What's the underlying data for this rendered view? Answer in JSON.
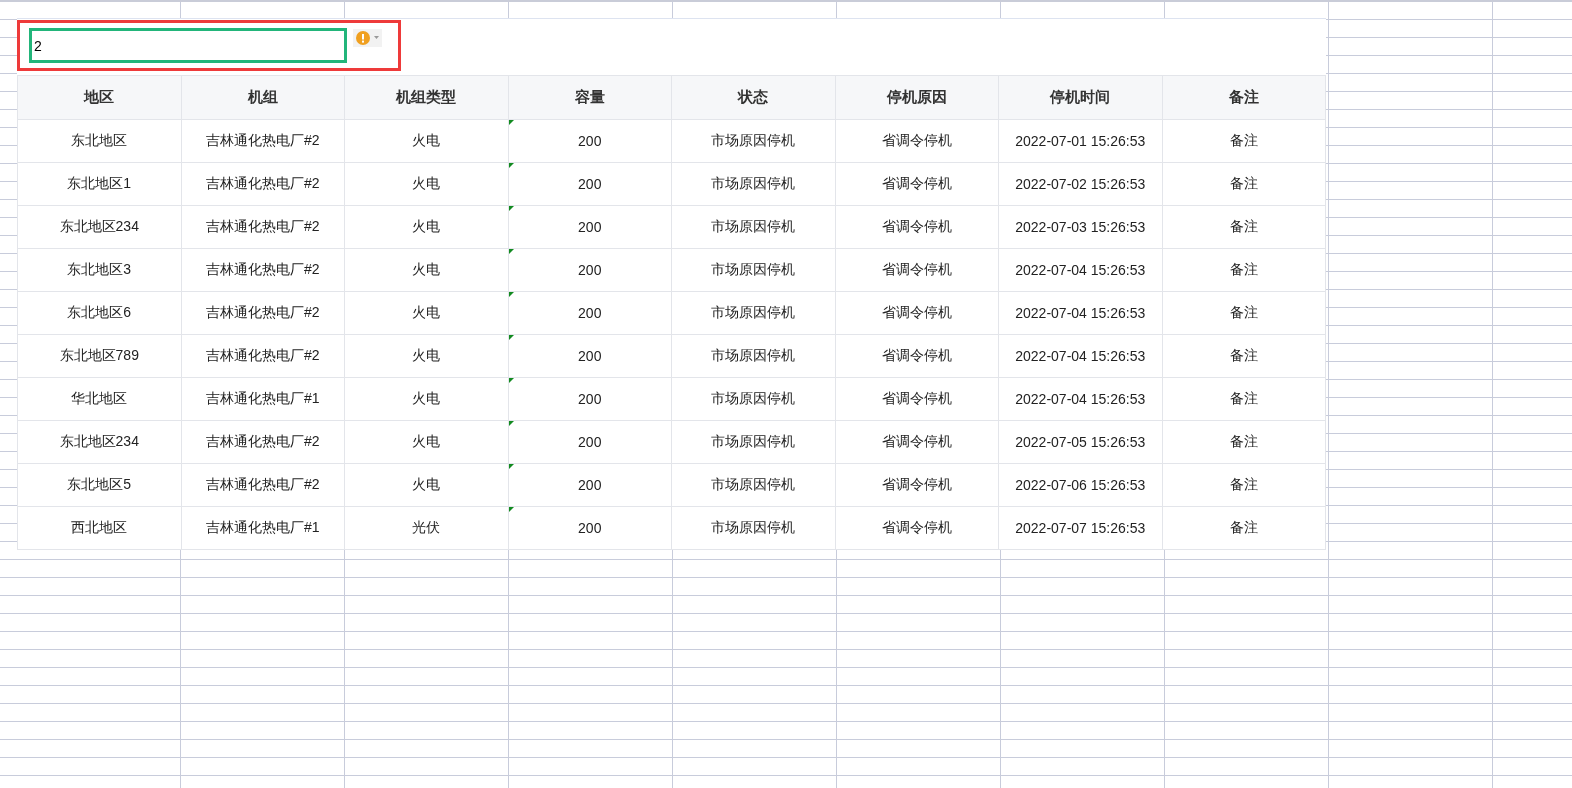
{
  "editor": {
    "value": "2",
    "warning": true
  },
  "table": {
    "columns": [
      "地区",
      "机组",
      "机组类型",
      "容量",
      "状态",
      "停机原因",
      "停机时间",
      "备注"
    ],
    "rows": [
      {
        "cells": [
          "东北地区",
          "吉林通化热电厂#2",
          "火电",
          "200",
          "市场原因停机",
          "省调令停机",
          "2022-07-01 15:26:53",
          "备注"
        ],
        "capacity_flagged": true
      },
      {
        "cells": [
          "东北地区1",
          "吉林通化热电厂#2",
          "火电",
          "200",
          "市场原因停机",
          "省调令停机",
          "2022-07-02 15:26:53",
          "备注"
        ],
        "capacity_flagged": true
      },
      {
        "cells": [
          "东北地区234",
          "吉林通化热电厂#2",
          "火电",
          "200",
          "市场原因停机",
          "省调令停机",
          "2022-07-03 15:26:53",
          "备注"
        ],
        "capacity_flagged": true
      },
      {
        "cells": [
          "东北地区3",
          "吉林通化热电厂#2",
          "火电",
          "200",
          "市场原因停机",
          "省调令停机",
          "2022-07-04 15:26:53",
          "备注"
        ],
        "capacity_flagged": true
      },
      {
        "cells": [
          "东北地区6",
          "吉林通化热电厂#2",
          "火电",
          "200",
          "市场原因停机",
          "省调令停机",
          "2022-07-04 15:26:53",
          "备注"
        ],
        "capacity_flagged": true
      },
      {
        "cells": [
          "东北地区789",
          "吉林通化热电厂#2",
          "火电",
          "200",
          "市场原因停机",
          "省调令停机",
          "2022-07-04 15:26:53",
          "备注"
        ],
        "capacity_flagged": true
      },
      {
        "cells": [
          "华北地区",
          "吉林通化热电厂#1",
          "火电",
          "200",
          "市场原因停机",
          "省调令停机",
          "2022-07-04 15:26:53",
          "备注"
        ],
        "capacity_flagged": true
      },
      {
        "cells": [
          "东北地区234",
          "吉林通化热电厂#2",
          "火电",
          "200",
          "市场原因停机",
          "省调令停机",
          "2022-07-05 15:26:53",
          "备注"
        ],
        "capacity_flagged": true
      },
      {
        "cells": [
          "东北地区5",
          "吉林通化热电厂#2",
          "火电",
          "200",
          "市场原因停机",
          "省调令停机",
          "2022-07-06 15:26:53",
          "备注"
        ],
        "capacity_flagged": true
      },
      {
        "cells": [
          "西北地区",
          "吉林通化热电厂#1",
          "光伏",
          "200",
          "市场原因停机",
          "省调令停机",
          "2022-07-07 15:26:53",
          "备注"
        ],
        "capacity_flagged": true
      }
    ]
  }
}
